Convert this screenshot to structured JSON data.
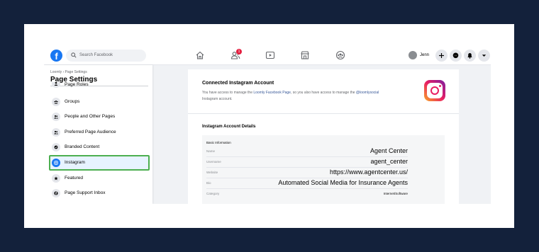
{
  "topbar": {
    "search_placeholder": "Search Facebook",
    "user_name": "Jenn",
    "notification_count": "1",
    "logo_letter": "f"
  },
  "sidebar": {
    "breadcrumb": "Loomly › Page Settings",
    "title": "Page Settings",
    "items": [
      {
        "label": "Page Roles",
        "icon": "user-key-icon"
      },
      {
        "label": "Groups",
        "icon": "groups-icon"
      },
      {
        "label": "People and Other Pages",
        "icon": "people-icon"
      },
      {
        "label": "Preferred Page Audience",
        "icon": "audience-icon"
      },
      {
        "label": "Branded Content",
        "icon": "badge-icon"
      },
      {
        "label": "Instagram",
        "icon": "instagram-icon"
      },
      {
        "label": "Featured",
        "icon": "star-icon"
      },
      {
        "label": "Page Support Inbox",
        "icon": "facebook-icon"
      }
    ],
    "active_item": "Instagram"
  },
  "main": {
    "card_title": "Connected Instagram Account",
    "desc_prefix": "You have access to manage the ",
    "desc_page": "Loomly Facebook Page",
    "desc_middle": ", so you also have access to manage the ",
    "desc_account": "@loomlysocial",
    "desc_suffix": " Instagram account.",
    "section_title": "Instagram Account Details",
    "details_heading": "Basic Information",
    "details": [
      {
        "label": "Name",
        "value": "Agent Center"
      },
      {
        "label": "Username",
        "value": "agent_center"
      },
      {
        "label": "Website",
        "value": "https://www.agentcenter.us/"
      },
      {
        "label": "Bio",
        "value": "Automated Social Media for Insurance Agents"
      },
      {
        "label": "Category",
        "value": "Internet/Software"
      }
    ]
  },
  "colors": {
    "page_background": "#13213b",
    "facebook_blue": "#1877f2",
    "active_outline": "#4caf50",
    "notification_red": "#e41e3f"
  }
}
